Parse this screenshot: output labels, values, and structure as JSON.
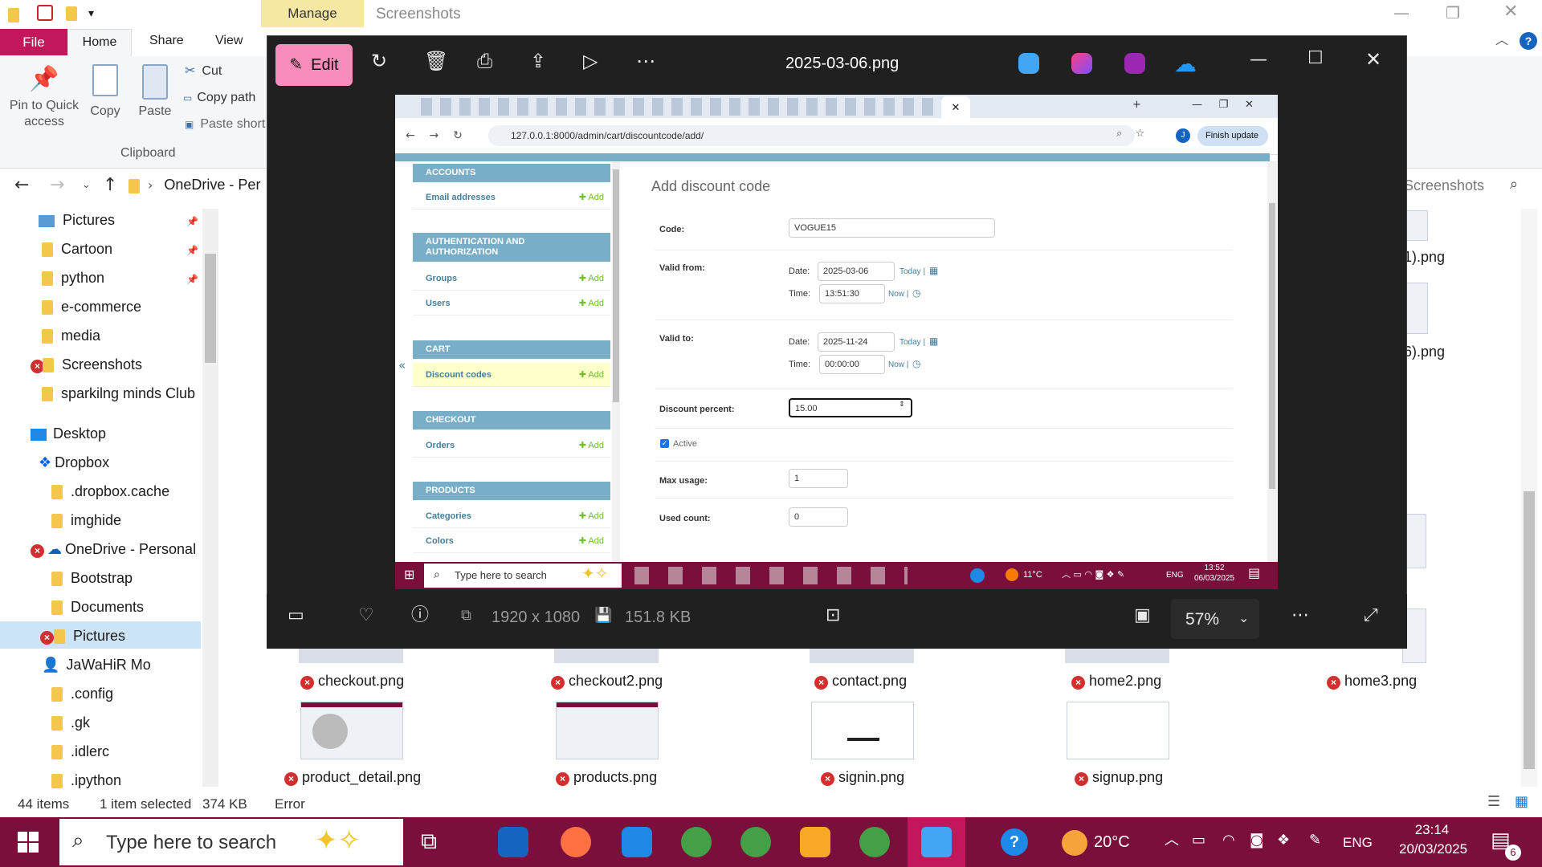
{
  "explorer": {
    "manage_label": "Manage",
    "window_title": "Screenshots",
    "tabs": {
      "file": "File",
      "home": "Home",
      "share": "Share",
      "view": "View"
    },
    "ribbon": {
      "pin": "Pin to Quick\naccess",
      "copy": "Copy",
      "paste": "Paste",
      "cut": "Cut",
      "copy_path": "Copy path",
      "paste_shortcut": "Paste short",
      "group_clipboard": "Clipboard"
    },
    "address": {
      "path": "OneDrive - Per",
      "search_placeholder": "Screenshots"
    },
    "nav_items": [
      {
        "label": "Pictures",
        "pinned": true
      },
      {
        "label": "Cartoon",
        "pinned": true
      },
      {
        "label": "python",
        "pinned": true
      },
      {
        "label": "e-commerce"
      },
      {
        "label": "media"
      },
      {
        "label": "Screenshots",
        "error": true
      },
      {
        "label": "sparkilng minds Club"
      },
      {
        "label": "Desktop"
      },
      {
        "label": "Dropbox"
      },
      {
        "label": ".dropbox.cache"
      },
      {
        "label": "imghide"
      },
      {
        "label": "OneDrive - Personal",
        "error": true
      },
      {
        "label": "Bootstrap"
      },
      {
        "label": "Documents"
      },
      {
        "label": "Pictures",
        "error": true,
        "selected": true
      },
      {
        "label": "JaWaHiR Mo"
      },
      {
        "label": ".config"
      },
      {
        "label": ".gk"
      },
      {
        "label": ".idlerc"
      },
      {
        "label": ".ipython"
      }
    ],
    "files_partial": [
      "1).png",
      "6).png"
    ],
    "files_row1": [
      "checkout.png",
      "checkout2.png",
      "contact.png",
      "home2.png",
      "home3.png"
    ],
    "files_row2": [
      "product_detail.png",
      "products.png",
      "signin.png",
      "signup.png"
    ],
    "status": {
      "count": "44 items",
      "selected": "1 item selected",
      "size": "374 KB",
      "state": "Error"
    }
  },
  "taskbar": {
    "search_placeholder": "Type here to search",
    "weather": "20°C",
    "language": "ENG",
    "time": "23:14",
    "date": "20/03/2025",
    "notifications": "6"
  },
  "viewer": {
    "edit_label": "Edit",
    "file_title": "2025-03-06.png",
    "dimensions": "1920 x 1080",
    "file_size": "151.8 KB",
    "zoom": "57%"
  },
  "inner": {
    "url": "127.0.0.1:8000/admin/cart/discountcode/add/",
    "update_button": "Finish update",
    "page_title": "Add discount code",
    "sidebar": [
      {
        "header": "ACCOUNTS",
        "rows": [
          "Email addresses"
        ]
      },
      {
        "header": "AUTHENTICATION AND AUTHORIZATION",
        "rows": [
          "Groups",
          "Users"
        ]
      },
      {
        "header": "CART",
        "rows": [
          "Discount codes"
        ]
      },
      {
        "header": "CHECKOUT",
        "rows": [
          "Orders"
        ]
      },
      {
        "header": "PRODUCTS",
        "rows": [
          "Categories",
          "Colors"
        ]
      }
    ],
    "add_label": "Add",
    "form": {
      "code_label": "Code:",
      "code_value": "VOGUE15",
      "valid_from_label": "Valid from:",
      "valid_to_label": "Valid to:",
      "date_label": "Date:",
      "time_label": "Time:",
      "from_date": "2025-03-06",
      "from_time": "13:51:30",
      "to_date": "2025-11-24",
      "to_time": "00:00:00",
      "today_link": "Today |",
      "now_link": "Now |",
      "discount_label": "Discount percent:",
      "discount_value": "15.00",
      "active_label": "Active",
      "max_usage_label": "Max usage:",
      "max_usage_value": "1",
      "used_count_label": "Used count:",
      "used_count_value": "0"
    },
    "taskbar": {
      "search": "Type here to search",
      "temp": "11°C",
      "lang": "ENG",
      "time": "13:52",
      "date": "06/03/2025"
    }
  },
  "colors": {
    "accent_pink": "#f88dbb",
    "taskbar": "#7a0f3c",
    "file_tab": "#c2185b",
    "django_blue": "#79aec8"
  }
}
